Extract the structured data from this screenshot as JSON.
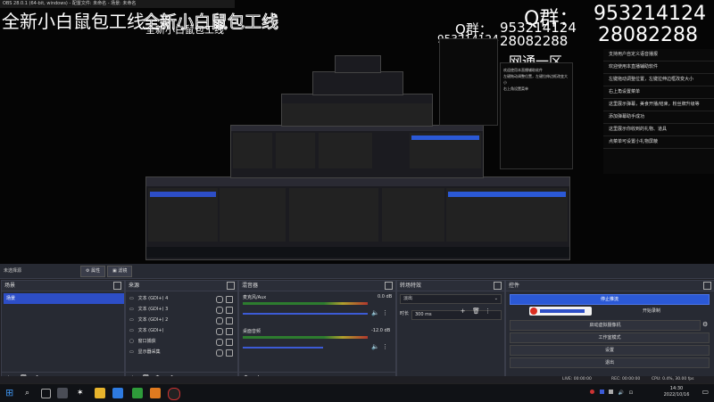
{
  "window": {
    "title": "OBS 28.0.1 (64-bit, windows) - 配置文件: 未命名 - 场景: 未命名"
  },
  "watermark": {
    "slogan": "全新小白鼠包工线",
    "qq_prefix": "Q群：",
    "qq_number_1": "953214124",
    "qq_number_2": "28082288",
    "network_label": "网通一区"
  },
  "side_panel": {
    "items": [
      "支持用户自定义语音播报",
      "欢迎使用本直播辅助软件",
      "左键拖动调整位置，左键拉伸边框改变大小",
      "右上角设置菜单",
      "这里展示弹幕，美食开播/结束，粉丝牌升级等",
      "添加弹幕助手成功",
      "这里展示你收到的礼物、道具",
      "点菜单可设置小礼物屏蔽"
    ]
  },
  "obs": {
    "scene_status": "未选择源",
    "top_buttons": {
      "properties": "属性",
      "filters": "滤镜"
    },
    "docks": {
      "scenes": "场景",
      "sources": "来源",
      "mixer": "混音器",
      "transitions": "转场特效",
      "controls": "控件"
    },
    "scenes": [
      "场景"
    ],
    "sources": [
      {
        "label": "文本 (GDI+) 4"
      },
      {
        "label": "文本 (GDI+) 3"
      },
      {
        "label": "文本 (GDI+) 2"
      },
      {
        "label": "文本 (GDI+)"
      },
      {
        "label": "窗口捕获"
      },
      {
        "label": "显示器采集"
      }
    ],
    "mixer": [
      {
        "name": "麦克风/Aux",
        "db": "0.0 dB"
      },
      {
        "name": "桌面音频",
        "db": "-12.0 dB"
      }
    ],
    "transitions": {
      "type": "淡出",
      "duration_label": "时长",
      "duration_value": "300 ms"
    },
    "controls": {
      "stop_stream": "停止推流",
      "start_recording": "开始录制",
      "virtual_camera": "启动虚拟摄像机",
      "studio_mode": "工作室模式",
      "settings": "设置",
      "exit": "退出"
    },
    "status": {
      "live": "LIVE: 00:00:00",
      "rec": "REC: 00:00:00",
      "cpu": "CPU: 0.4%, 30.00 fps"
    }
  },
  "taskbar": {
    "time": "14:30",
    "date": "2022/10/16"
  },
  "colors": {
    "accent": "#2d4ec7",
    "background": "#272a33"
  }
}
